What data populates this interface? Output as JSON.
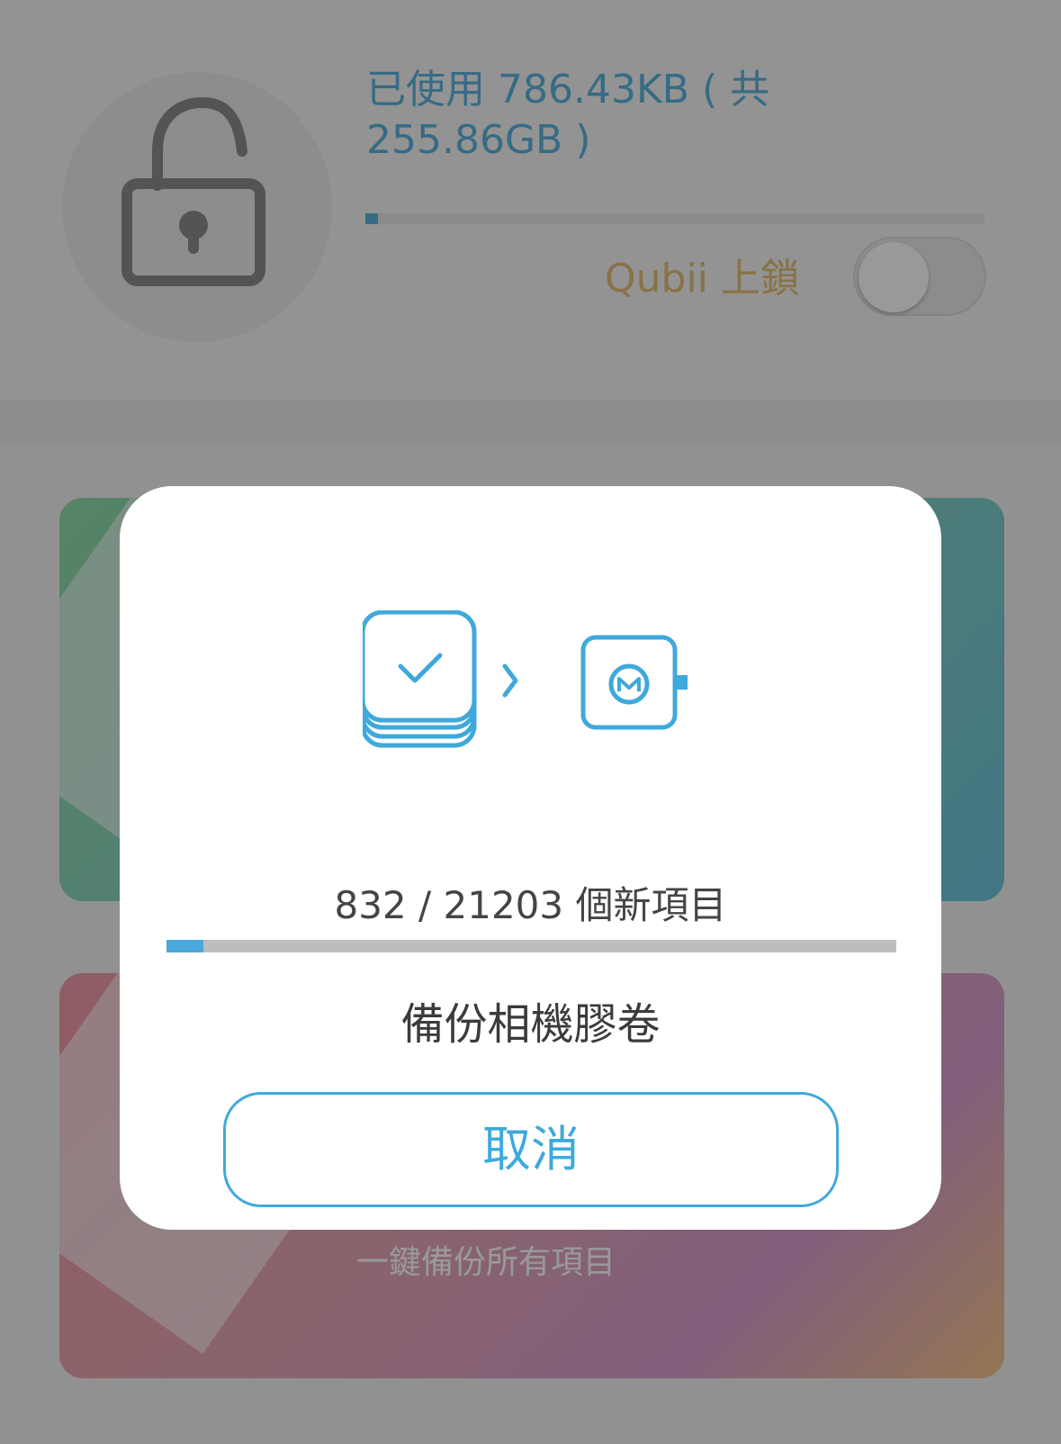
{
  "header": {
    "storage_text": "已使用 786.43KB ( 共 255.86GB )",
    "storage_fraction": 0.02,
    "lock_label": "Qubii 上鎖",
    "lock_enabled": false
  },
  "cards": {
    "bottom_subtitle": "一鍵備份所有項目"
  },
  "dialog": {
    "progress_text": "832 / 21203 個新項目",
    "progress_done": 832,
    "progress_total": 21203,
    "title": "備份相機膠卷",
    "cancel_label": "取消"
  },
  "colors": {
    "accent": "#3fa9db",
    "lock_label": "#e3bf75",
    "progress_track": "#bdbdbd"
  },
  "icons": {
    "lock": "unlocked-padlock-icon",
    "phone_stack": "photo-stack-check-icon",
    "arrow": "chevron-right-icon",
    "device": "qubii-device-icon"
  }
}
